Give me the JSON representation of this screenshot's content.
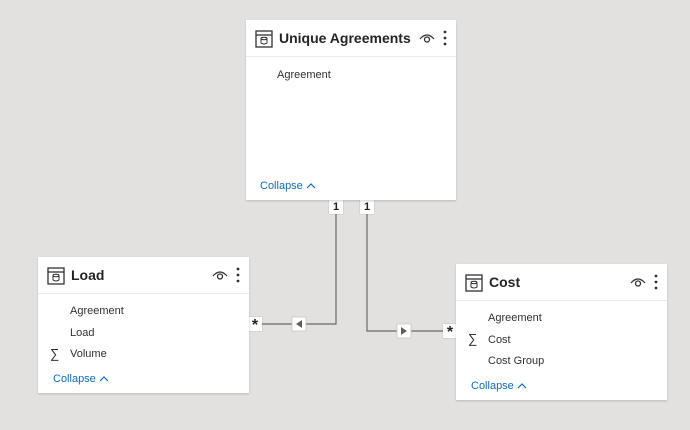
{
  "tables": {
    "unique_agreements": {
      "title": "Unique Agreements",
      "fields": [
        "Agreement"
      ],
      "collapse": "Collapse"
    },
    "load": {
      "title": "Load",
      "fields": [
        "Agreement",
        "Load",
        "Volume"
      ],
      "collapse": "Collapse"
    },
    "cost": {
      "title": "Cost",
      "fields": [
        "Agreement",
        "Cost",
        "Cost Group"
      ],
      "collapse": "Collapse"
    }
  },
  "relationships": {
    "load_one": "1",
    "load_many": "*",
    "cost_one": "1",
    "cost_many": "*"
  },
  "icons": [
    "table-icon",
    "eye-icon",
    "more-options-icon",
    "sigma-icon",
    "chevron-up-icon",
    "arrow-left-icon",
    "arrow-right-icon"
  ],
  "colors": {
    "canvas": "#e2e1df",
    "link": "#0f6cbd",
    "line": "#6b6a69"
  }
}
